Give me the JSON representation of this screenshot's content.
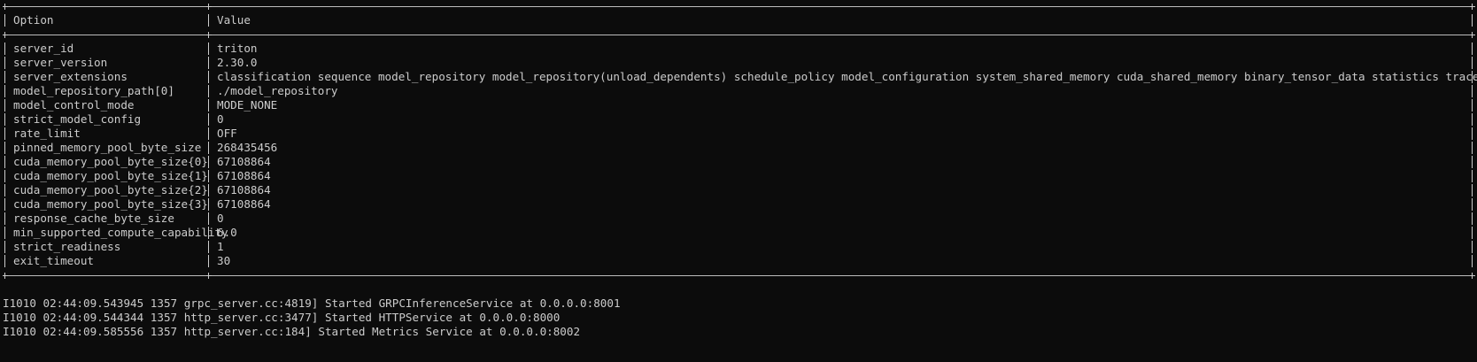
{
  "table": {
    "headers": {
      "option": "Option",
      "value": "Value"
    },
    "rows": [
      {
        "option": "server_id",
        "value": "triton"
      },
      {
        "option": "server_version",
        "value": "2.30.0"
      },
      {
        "option": "server_extensions",
        "value": "classification sequence model_repository model_repository(unload_dependents) schedule_policy model_configuration system_shared_memory cuda_shared_memory binary_tensor_data statistics trace logging"
      },
      {
        "option": "model_repository_path[0]",
        "value": "./model_repository"
      },
      {
        "option": "model_control_mode",
        "value": "MODE_NONE"
      },
      {
        "option": "strict_model_config",
        "value": "0"
      },
      {
        "option": "rate_limit",
        "value": "OFF"
      },
      {
        "option": "pinned_memory_pool_byte_size",
        "value": "268435456"
      },
      {
        "option": "cuda_memory_pool_byte_size{0}",
        "value": "67108864"
      },
      {
        "option": "cuda_memory_pool_byte_size{1}",
        "value": "67108864"
      },
      {
        "option": "cuda_memory_pool_byte_size{2}",
        "value": "67108864"
      },
      {
        "option": "cuda_memory_pool_byte_size{3}",
        "value": "67108864"
      },
      {
        "option": "response_cache_byte_size",
        "value": "0"
      },
      {
        "option": "min_supported_compute_capability",
        "value": "6.0"
      },
      {
        "option": "strict_readiness",
        "value": "1"
      },
      {
        "option": "exit_timeout",
        "value": "30"
      }
    ]
  },
  "logs": [
    "I1010 02:44:09.543945 1357 grpc_server.cc:4819] Started GRPCInferenceService at 0.0.0.0:8001",
    "I1010 02:44:09.544344 1357 http_server.cc:3477] Started HTTPService at 0.0.0.0:8000",
    "I1010 02:44:09.585556 1357 http_server.cc:184] Started Metrics Service at 0.0.0.0:8002"
  ]
}
